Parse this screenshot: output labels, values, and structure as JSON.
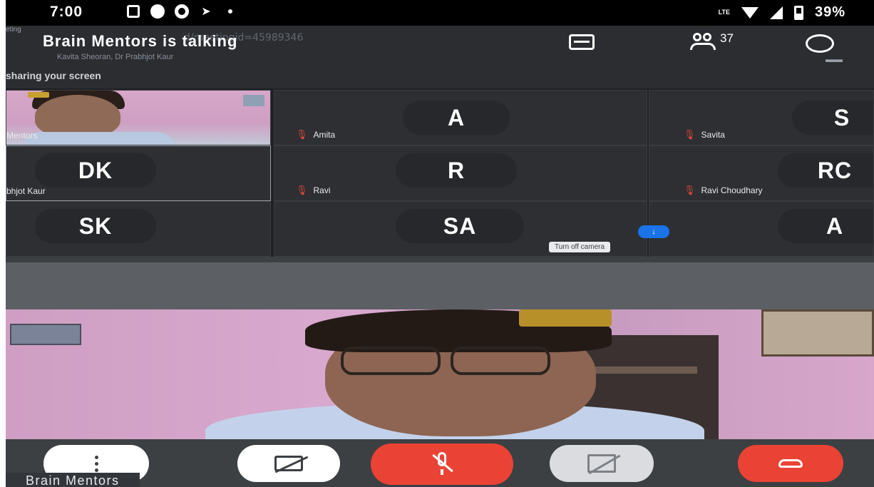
{
  "status_bar": {
    "time": "7:00",
    "network": "LTE",
    "battery": "39%"
  },
  "browser": {
    "tab_title": "eting",
    "url": "d/meetingid=45989346",
    "attendees_line": "Kavita Sheoran, Dr Prabhjot Kaur",
    "sharing_text": "sharing your screen"
  },
  "meeting": {
    "talking_banner": "Brain Mentors is talking",
    "participant_count": "37"
  },
  "tiles": [
    {
      "initials": "",
      "name": "Mentors",
      "video": true
    },
    {
      "initials": "A",
      "name": "Amita",
      "muted": true
    },
    {
      "initials": "S",
      "name": "Savita",
      "muted": true
    },
    {
      "initials": "DK",
      "name": "bhjot Kaur",
      "muted": false
    },
    {
      "initials": "R",
      "name": "Ravi",
      "muted": true
    },
    {
      "initials": "RC",
      "name": "Ravi Choudhary",
      "muted": true
    },
    {
      "initials": "SK",
      "name": ""
    },
    {
      "initials": "SA",
      "name": ""
    },
    {
      "initials": "A",
      "name": ""
    }
  ],
  "tooltip": "Turn off camera",
  "self_view_name": "Brain Mentors",
  "colors": {
    "accent_red": "#ea4335",
    "accent_blue": "#1a73e8",
    "surface": "#3c4043"
  },
  "icons": [
    "more-options-icon",
    "camera-off-icon",
    "mic-off-icon",
    "screen-share-off-icon",
    "hang-up-icon"
  ]
}
